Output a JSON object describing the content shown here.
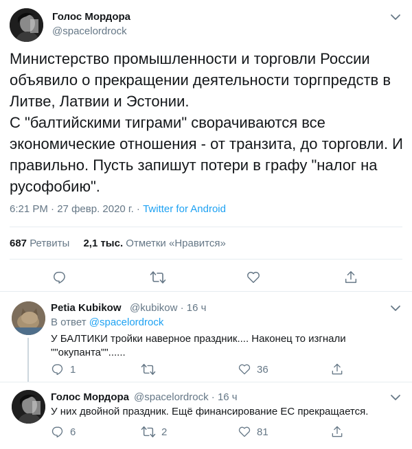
{
  "main_tweet": {
    "author_name": "Голос Мордора",
    "author_handle": "@spacelordrock",
    "text": "Министерство промышленности и торговли России объявило о прекращении деятельности торгпредств в Литве, Латвии и Эстонии.\nС \"балтийскими тиграми\" сворачиваются все экономические отношения - от транзита, до торговли. И правильно. Пусть запишут потери в графу \"налог на русофобию\".",
    "time": "6:21 PM",
    "date": "27 февр. 2020 г.",
    "separator": "·",
    "source": "Twitter for Android",
    "retweets_count": "687",
    "retweets_label": "Ретвиты",
    "likes_count": "2,1 тыс.",
    "likes_label": "Отметки «Нравится»"
  },
  "replies": [
    {
      "author_name": "Petia Kubikow",
      "author_handle": "@kubikow",
      "time": "· 16 ч",
      "reply_prefix": "В ответ",
      "reply_mention": "@spacelordrock",
      "text": "У БАЛТИКИ тройки наверное праздник.... Наконец то изгнали \"\"окупанта\"\"......",
      "reply_count": "1",
      "retweet_count": "",
      "like_count": "36"
    },
    {
      "author_name": "Голос Мордора",
      "author_handle": "@spacelordrock",
      "time": "· 16 ч",
      "text": "У них двойной праздник. Ещё финансирование ЕС прекращается.",
      "reply_count": "6",
      "retweet_count": "2",
      "like_count": "81"
    }
  ],
  "icons": {
    "reply": "speech-bubble-icon",
    "retweet": "retweet-icon",
    "like": "heart-icon",
    "share": "share-icon",
    "menu": "chevron-down-icon"
  },
  "colors": {
    "accent": "#1da1f2",
    "secondary_text": "#657786",
    "border": "#e6ecf0"
  }
}
